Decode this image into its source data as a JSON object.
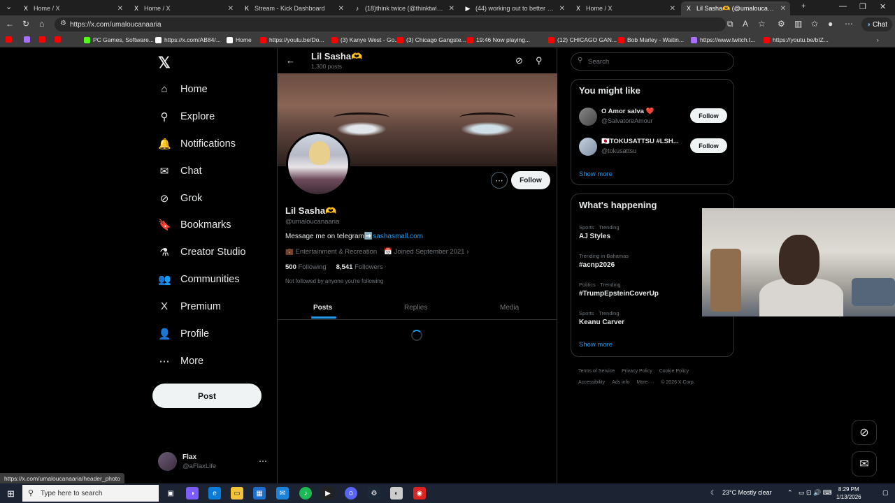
{
  "browser": {
    "tabs": [
      {
        "icon": "X",
        "title": "Home / X",
        "active": false
      },
      {
        "icon": "X",
        "title": "Home / X",
        "active": false
      },
      {
        "icon": "K",
        "title": "Stream - Kick Dashboard",
        "active": false
      },
      {
        "icon": "♪",
        "title": "(18)think twice (@thinktwice101",
        "active": false
      },
      {
        "icon": "▶",
        "title": "(44) working out to better my he",
        "active": false
      },
      {
        "icon": "X",
        "title": "Home / X",
        "active": false
      },
      {
        "icon": "X",
        "title": "Lil Sasha🫶 (@umaloucanaaria) /",
        "active": true
      }
    ],
    "url": "https://x.com/umaloucanaaria",
    "chat_label": "Chat",
    "bookmarks": [
      {
        "label": "",
        "color": "#ff0000"
      },
      {
        "label": "",
        "color": "#a970ff"
      },
      {
        "label": "",
        "color": "#ff0000"
      },
      {
        "label": "",
        "color": "#ff0000"
      },
      {
        "label": "PC Games, Software...",
        "color": "#53fc18"
      },
      {
        "label": "https://x.com/AB84/...",
        "color": "#ffffff"
      },
      {
        "label": "Home",
        "color": "#ffffff"
      },
      {
        "label": "https://youtu.be/Do...",
        "color": "#ff0000"
      },
      {
        "label": "(3) Kanye West - Go...",
        "color": "#ff0000"
      },
      {
        "label": "(3) Chicago Gangste...",
        "color": "#ff0000"
      },
      {
        "label": "19:46 Now playing...",
        "color": "#ff0000"
      },
      {
        "label": "(12) CHICAGO GAN...",
        "color": "#ff0000"
      },
      {
        "label": "Bob Marley - Waitin...",
        "color": "#ff0000"
      },
      {
        "label": "https://www.twitch.t...",
        "color": "#a970ff"
      },
      {
        "label": "https://youtu.be/bIZ...",
        "color": "#ff0000"
      }
    ],
    "status_url": "https://x.com/umaloucanaaria/header_photo"
  },
  "nav": {
    "items": [
      {
        "label": "Home",
        "icon": "⌂"
      },
      {
        "label": "Explore",
        "icon": "⚲"
      },
      {
        "label": "Notifications",
        "icon": "🔔"
      },
      {
        "label": "Chat",
        "icon": "✉"
      },
      {
        "label": "Grok",
        "icon": "⊘"
      },
      {
        "label": "Bookmarks",
        "icon": "🔖"
      },
      {
        "label": "Creator Studio",
        "icon": "⚗"
      },
      {
        "label": "Communities",
        "icon": "👥"
      },
      {
        "label": "Premium",
        "icon": "X"
      },
      {
        "label": "Profile",
        "icon": "👤"
      },
      {
        "label": "More",
        "icon": "⋯"
      }
    ],
    "post_label": "Post",
    "account": {
      "name": "Flax",
      "handle": "@aFlaxLife"
    }
  },
  "profile": {
    "top_name": "Lil Sasha🫶",
    "post_count": "1,300 posts",
    "name": "Lil Sasha🫶",
    "handle": "@umaloucanaaria",
    "bio_text": "Message me on telegram➡️",
    "bio_link": "sashasmall.com",
    "category": "Entertainment & Recreation",
    "joined": "Joined September 2021",
    "following_count": "500",
    "following_label": "Following",
    "followers_count": "8,541",
    "followers_label": "Followers",
    "follow_note": "Not followed by anyone you're following",
    "follow_label": "Follow",
    "tabs": [
      "Posts",
      "Replies",
      "Media"
    ]
  },
  "sidebar": {
    "search_placeholder": "Search",
    "suggest_title": "You might like",
    "suggestions": [
      {
        "name": "O Amor salva ❤️",
        "handle": "@SalvatoreAmour",
        "follow": "Follow"
      },
      {
        "name": "🇯🇵TOKUSATTSU #LSH...",
        "handle": "@tokusattsu",
        "follow": "Follow"
      }
    ],
    "show_more": "Show more",
    "happening_title": "What's happening",
    "trends": [
      {
        "context": "Sports · Trending",
        "title": "AJ Styles"
      },
      {
        "context": "Trending in Bahamas",
        "title": "#acnp2026"
      },
      {
        "context": "Politics · Trending",
        "title": "#TrumpEpsteinCoverUp"
      },
      {
        "context": "Sports · Trending",
        "title": "Keanu Carver"
      }
    ],
    "show_more_2": "Show more",
    "footer": [
      "Terms of Service",
      "Privacy Policy",
      "Cookie Policy",
      "Accessibility",
      "Ads info",
      "More ···",
      "© 2026 X Corp."
    ]
  },
  "taskbar": {
    "search_placeholder": "Type here to search",
    "weather": "23°C  Mostly clear",
    "time": "8:29 PM",
    "date": "1/13/2026"
  }
}
